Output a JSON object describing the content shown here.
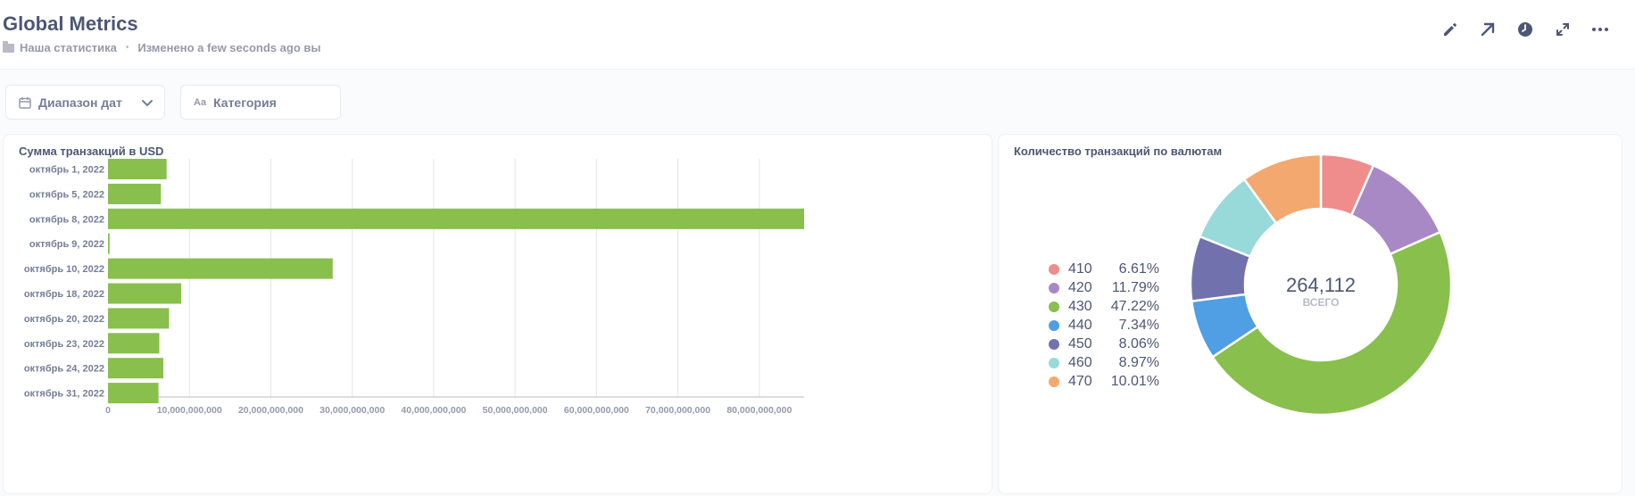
{
  "header": {
    "title": "Global Metrics",
    "collection": "Наша статистика",
    "separator": "•",
    "edited_prefix": "Изменено",
    "edited_time": "a few seconds ago",
    "edited_by": "вы"
  },
  "actions": [
    {
      "icon": "pencil-icon"
    },
    {
      "icon": "arrow-up-right-icon"
    },
    {
      "icon": "clock-icon"
    },
    {
      "icon": "expand-icon"
    },
    {
      "icon": "more-icon"
    }
  ],
  "filters": {
    "date_label": "Диапазон дат",
    "category_icon_text": "Aa",
    "category_label": "Категория"
  },
  "bar_card": {
    "title": "Сумма транзакций в USD"
  },
  "pie_card": {
    "title": "Количество транзакций по валютам"
  },
  "colors": {
    "bar": "#88bf4d",
    "grid": "#e3e5ea",
    "axis_text": "#949aab",
    "label_text": "#747e96"
  },
  "chart_data": [
    {
      "type": "bar",
      "orientation": "horizontal",
      "title": "Сумма транзакций в USD",
      "categories": [
        "октябрь 1, 2022",
        "октябрь 5, 2022",
        "октябрь 8, 2022",
        "октябрь 9, 2022",
        "октябрь 10, 2022",
        "октябрь 18, 2022",
        "октябрь 20, 2022",
        "октябрь 23, 2022",
        "октябрь 24, 2022",
        "октябрь 31, 2022"
      ],
      "values": [
        7200000000,
        6500000000,
        85500000000,
        200000000,
        27600000000,
        9000000000,
        7500000000,
        6300000000,
        6800000000,
        6200000000
      ],
      "ticks": [
        "0",
        "10,000,000,000",
        "20,000,000,000",
        "30,000,000,000",
        "40,000,000,000",
        "50,000,000,000",
        "60,000,000,000",
        "70,000,000,000",
        "80,000,000,000"
      ],
      "xlim": [
        0,
        85500000000
      ],
      "grid": true
    },
    {
      "type": "pie",
      "donut": true,
      "title": "Количество транзакций по валютам",
      "total": "264,112",
      "total_label": "ВСЕГО",
      "series": [
        {
          "name": "410",
          "percent": "6.61%",
          "value": 6.61,
          "color": "#ef8c8c"
        },
        {
          "name": "420",
          "percent": "11.79%",
          "value": 11.79,
          "color": "#a989c5"
        },
        {
          "name": "430",
          "percent": "47.22%",
          "value": 47.22,
          "color": "#88bf4d"
        },
        {
          "name": "440",
          "percent": "7.34%",
          "value": 7.34,
          "color": "#509ee3"
        },
        {
          "name": "450",
          "percent": "8.06%",
          "value": 8.06,
          "color": "#7172ad"
        },
        {
          "name": "460",
          "percent": "8.97%",
          "value": 8.97,
          "color": "#98d9d9"
        },
        {
          "name": "470",
          "percent": "10.01%",
          "value": 10.01,
          "color": "#f2a86f"
        }
      ],
      "legend_position": "left"
    }
  ]
}
